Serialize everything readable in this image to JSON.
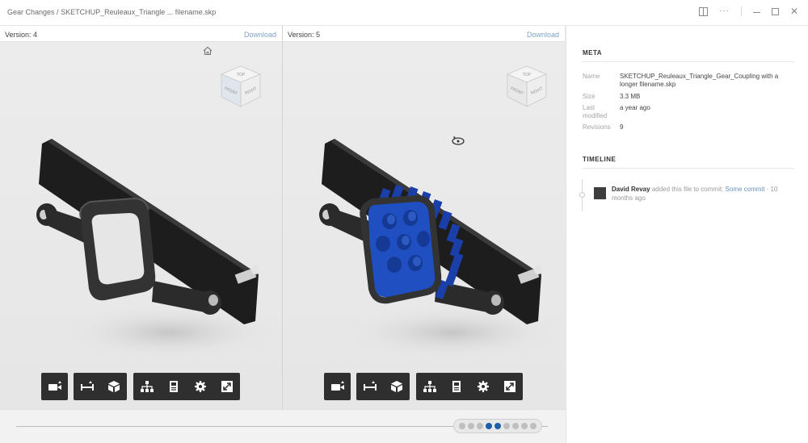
{
  "window": {
    "breadcrumb_root": "Gear Changes",
    "breadcrumb_sep": " / ",
    "breadcrumb_file": "SKETCHUP_Reuleaux_Triangle ... filename.skp",
    "controls": [
      "split-view-icon",
      "more-icon",
      "minimize-icon",
      "maximize-icon",
      "close-icon"
    ]
  },
  "panes": {
    "left": {
      "version_label": "Version: 4",
      "download_label": "Download"
    },
    "right": {
      "version_label": "Version: 5",
      "download_label": "Download"
    }
  },
  "viewcube": {
    "top": "TOP",
    "front": "FRONT",
    "right": "RIGHT"
  },
  "toolbar": {
    "groups": [
      [
        "camera-icon"
      ],
      [
        "measure-icon",
        "cube-icon"
      ],
      [
        "hierarchy-icon",
        "properties-icon",
        "settings-icon",
        "fullscreen-icon"
      ]
    ]
  },
  "scrubber": {
    "dot_count": 9,
    "active_dots": [
      4,
      5
    ]
  },
  "sidebar": {
    "meta_title": "META",
    "meta": [
      {
        "key": "Name",
        "value": "SKETCHUP_Reuleaux_Triangle_Gear_Coupling with a longer filename.skp"
      },
      {
        "key": "Size",
        "value": "3.3 MB"
      },
      {
        "key": "Last modified",
        "value": "a year ago"
      },
      {
        "key": "Revisions",
        "value": "9"
      }
    ],
    "timeline_title": "TIMELINE",
    "timeline": [
      {
        "author": "David Revay",
        "action": " added this file to commit: ",
        "commit": "Some commit",
        "time": " · 10 months ago"
      }
    ]
  },
  "colors": {
    "accent": "#1f5fa8",
    "link": "#7fa3c7",
    "gear_blue": "#1f4fc0",
    "toolbar_bg": "#2f2f2f"
  }
}
